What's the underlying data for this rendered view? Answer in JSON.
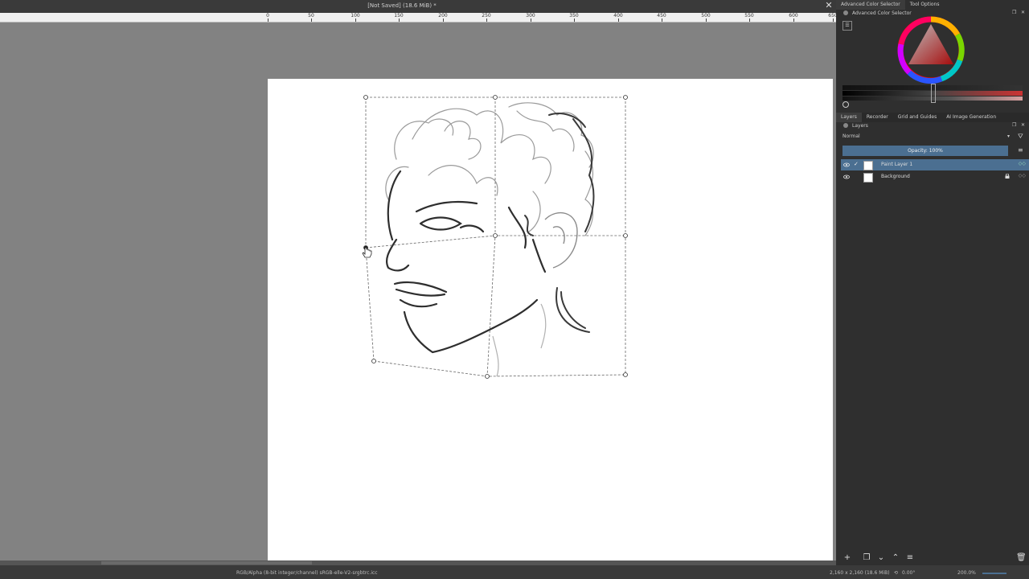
{
  "document": {
    "title": "[Not Saved]  (18.6 MiB) *",
    "close_icon": "close-icon"
  },
  "ruler": {
    "ticks": [
      "0",
      "50",
      "100",
      "150",
      "200",
      "250",
      "300",
      "350",
      "400",
      "450",
      "500",
      "550",
      "600",
      "650"
    ]
  },
  "right_panels": {
    "top_tabs": [
      "Advanced Color Selector",
      "Tool Options"
    ],
    "color_selector_title": "Advanced Color Selector",
    "layers_tabs": [
      "Layers",
      "Recorder",
      "Grid and Guides",
      "AI Image Generation"
    ],
    "layers_title": "Layers",
    "blend_mode": "Normal",
    "opacity_label": "Opacity:  100%",
    "layers": [
      {
        "name": "Paint Layer 1",
        "selected": true
      },
      {
        "name": "Background",
        "selected": false
      }
    ]
  },
  "status": {
    "color_profile": "RGB/Alpha (8-bit integer/channel)  sRGB-elle-V2-srgbtrc.icc",
    "image_size": "2,160 x 2,160 (18.6 MiB)",
    "rotation": "0.00°",
    "zoom": "200.0%"
  }
}
